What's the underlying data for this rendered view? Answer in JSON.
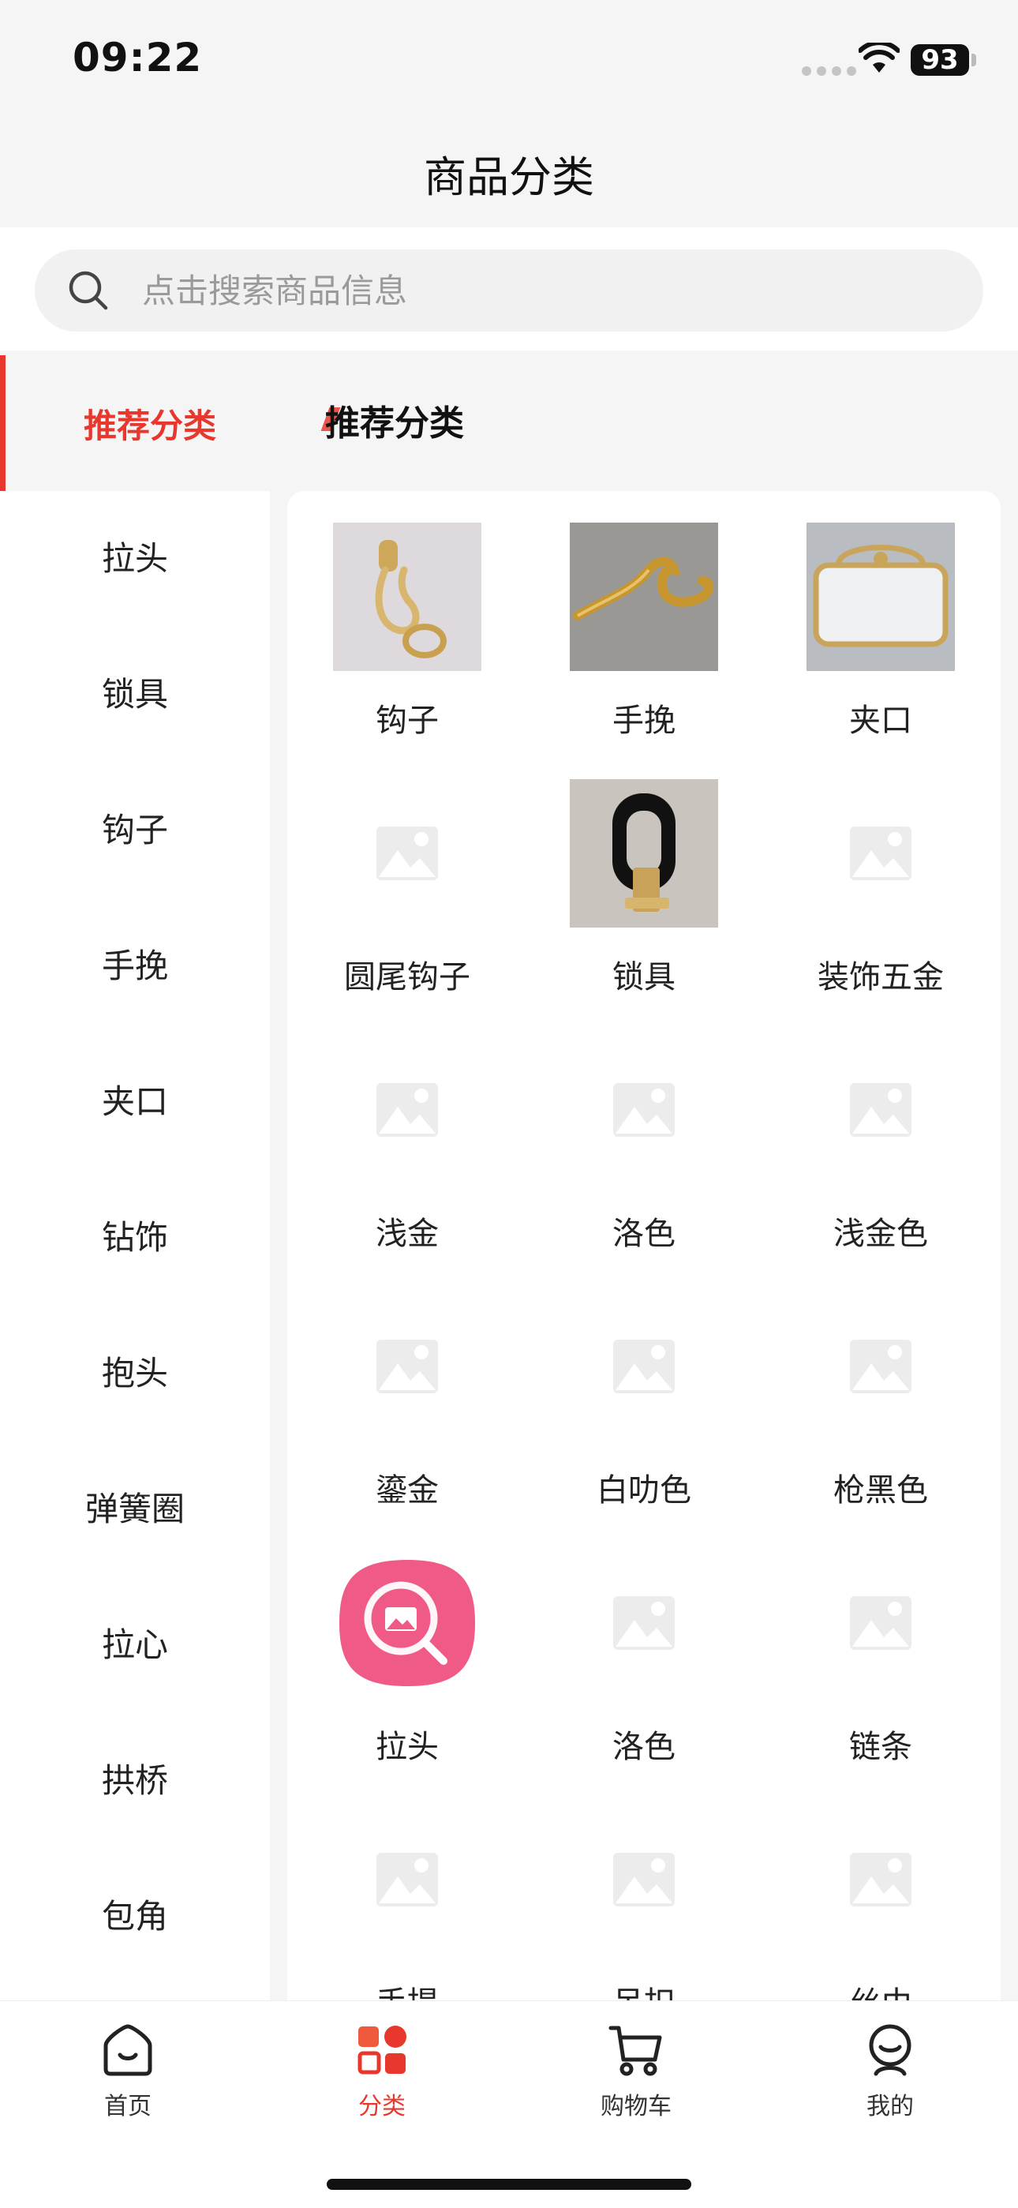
{
  "status_bar": {
    "time": "09:22",
    "battery": "93"
  },
  "header": {
    "title": "商品分类"
  },
  "search": {
    "placeholder": "点击搜索商品信息"
  },
  "category_header": {
    "active_label": "推荐分类",
    "section_title": "推荐分类"
  },
  "sidebar": {
    "items": [
      {
        "label": "拉头"
      },
      {
        "label": "锁具"
      },
      {
        "label": "钩子"
      },
      {
        "label": "手挽"
      },
      {
        "label": "夹口"
      },
      {
        "label": "钻饰"
      },
      {
        "label": "抱头"
      },
      {
        "label": "弹簧圈"
      },
      {
        "label": "拉心"
      },
      {
        "label": "拱桥"
      },
      {
        "label": "包角"
      }
    ]
  },
  "grid": {
    "items": [
      {
        "label": "钩子",
        "image": "gold-hook-photo"
      },
      {
        "label": "手挽",
        "image": "gold-handle-photo"
      },
      {
        "label": "夹口",
        "image": "bag-frame-photo"
      },
      {
        "label": "圆尾钩子",
        "image": "placeholder-image-icon"
      },
      {
        "label": "锁具",
        "image": "lock-photo"
      },
      {
        "label": "装饰五金",
        "image": "placeholder-image-icon"
      },
      {
        "label": "浅金",
        "image": "placeholder-image-icon"
      },
      {
        "label": "洛色",
        "image": "placeholder-image-icon"
      },
      {
        "label": "浅金色",
        "image": "placeholder-image-icon"
      },
      {
        "label": "鎏金",
        "image": "placeholder-image-icon"
      },
      {
        "label": "白叻色",
        "image": "placeholder-image-icon"
      },
      {
        "label": "枪黑色",
        "image": "placeholder-image-icon"
      },
      {
        "label": "拉头",
        "image": "image-search-app-icon"
      },
      {
        "label": "洛色",
        "image": "placeholder-image-icon"
      },
      {
        "label": "链条",
        "image": "placeholder-image-icon"
      },
      {
        "label": "手提",
        "image": "placeholder-image-icon"
      },
      {
        "label": "吊扣",
        "image": "placeholder-image-icon"
      },
      {
        "label": "丝巾",
        "image": "placeholder-image-icon"
      }
    ]
  },
  "tabbar": {
    "home": "首页",
    "category": "分类",
    "cart": "购物车",
    "mine": "我的"
  },
  "colors": {
    "accent": "#e8372c",
    "background": "#f5f5f5"
  }
}
